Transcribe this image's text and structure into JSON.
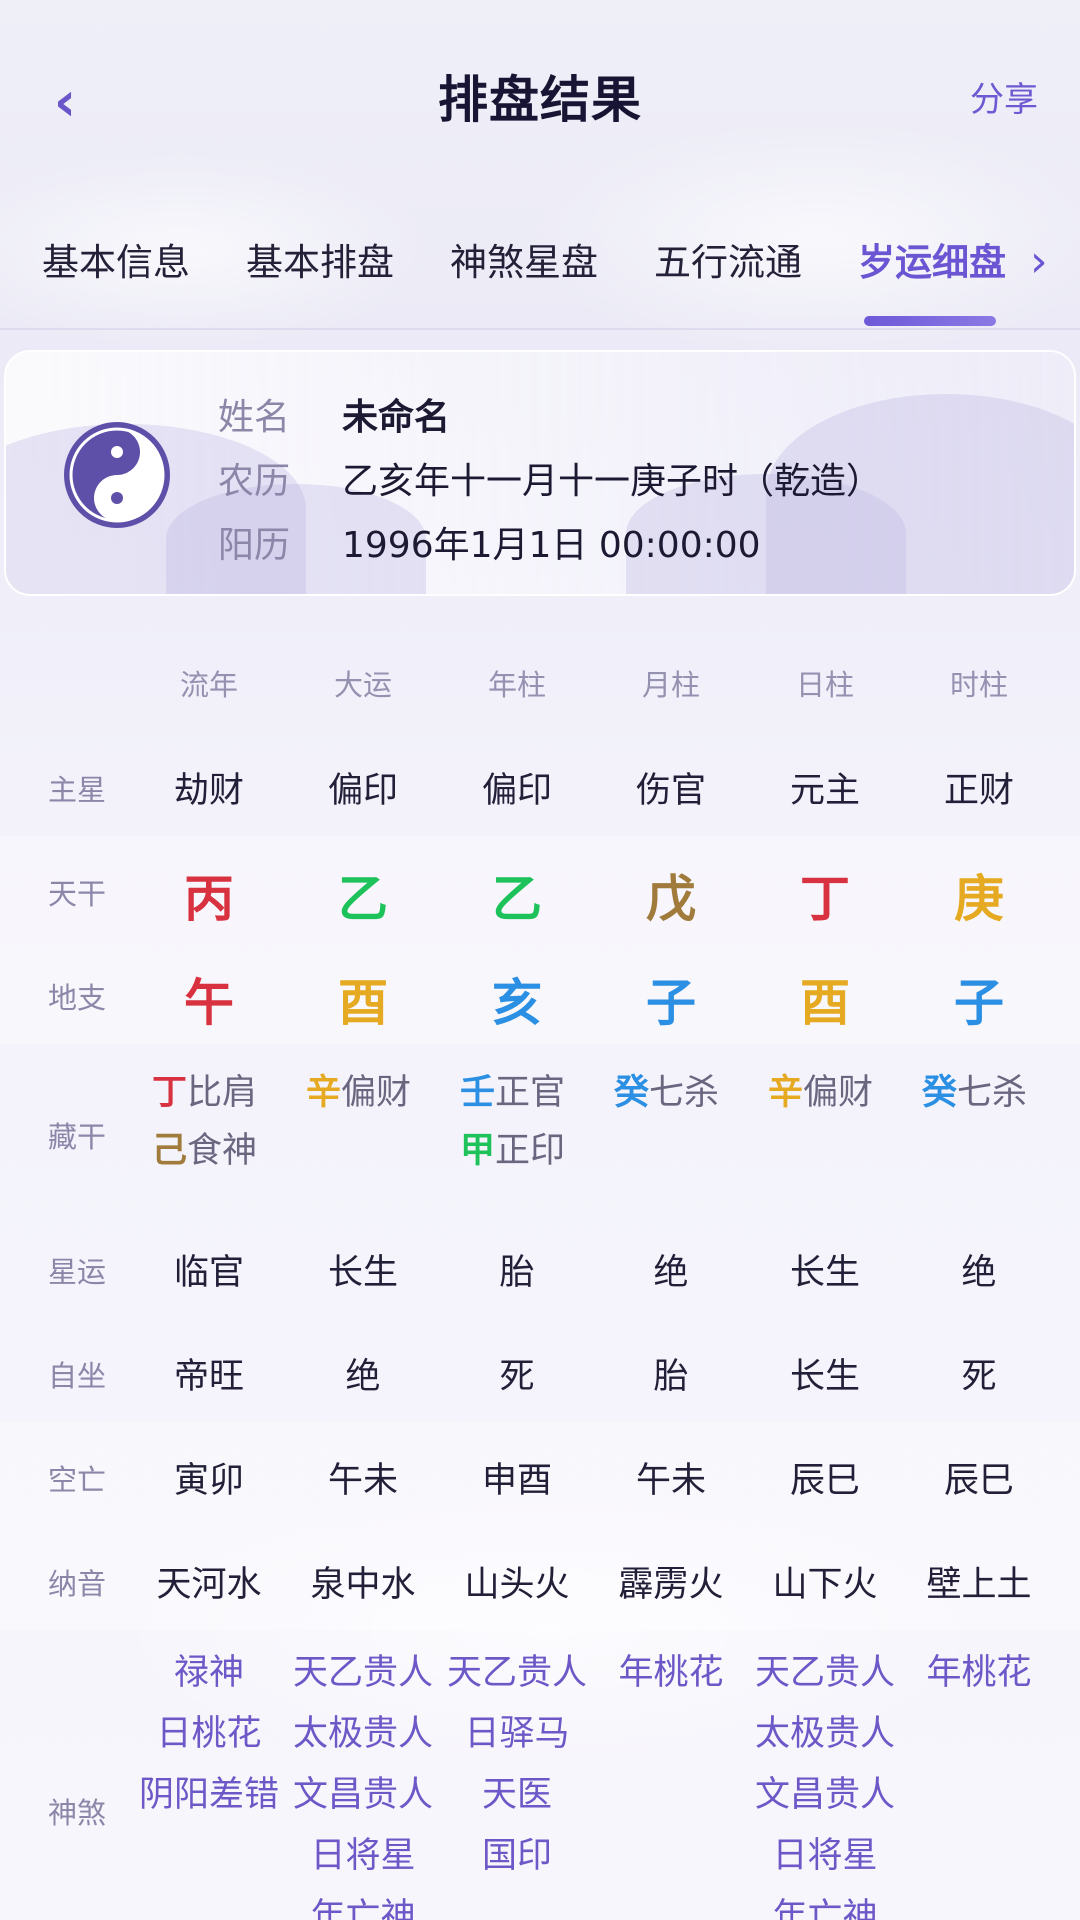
{
  "header": {
    "back_icon": "chevron-left-icon",
    "title": "排盘结果",
    "share_label": "分享"
  },
  "tabs": [
    {
      "label": "基本信息",
      "active": false
    },
    {
      "label": "基本排盘",
      "active": false
    },
    {
      "label": "神煞星盘",
      "active": false
    },
    {
      "label": "五行流通",
      "active": false
    },
    {
      "label": "岁运细盘",
      "active": true
    }
  ],
  "profile": {
    "icon": "yin-yang-icon",
    "name_label": "姓名",
    "name": "未命名",
    "lunar_label": "农历",
    "lunar": "乙亥年十一月十一庚子时（乾造）",
    "solar_label": "阳历",
    "solar": "1996年1月1日 00:00:00"
  },
  "table": {
    "columns": [
      "流年",
      "大运",
      "年柱",
      "月柱",
      "日柱",
      "时柱"
    ],
    "main_star": {
      "label": "主星",
      "values": [
        "劫财",
        "偏印",
        "偏印",
        "伤官",
        "元主",
        "正财"
      ]
    },
    "heavenly_stem": {
      "label": "天干",
      "values": [
        "丙",
        "乙",
        "乙",
        "戊",
        "丁",
        "庚"
      ],
      "colors": [
        "#d8313f",
        "#1ec25a",
        "#1ec25a",
        "#a07b3c",
        "#d8313f",
        "#e5aa22"
      ]
    },
    "earthly_branch": {
      "label": "地支",
      "values": [
        "午",
        "酉",
        "亥",
        "子",
        "酉",
        "子"
      ],
      "colors": [
        "#d8313f",
        "#e5aa22",
        "#2b8fe3",
        "#2b8fe3",
        "#e5aa22",
        "#2b8fe3"
      ]
    },
    "hidden_stems": {
      "label": "藏干",
      "cols": [
        [
          {
            "stem": "丁",
            "god": "比肩",
            "color": "#d8313f"
          },
          {
            "stem": "己",
            "god": "食神",
            "color": "#a07b3c"
          }
        ],
        [
          {
            "stem": "辛",
            "god": "偏财",
            "color": "#e5aa22"
          }
        ],
        [
          {
            "stem": "壬",
            "god": "正官",
            "color": "#2b8fe3"
          },
          {
            "stem": "甲",
            "god": "正印",
            "color": "#1ec25a"
          }
        ],
        [
          {
            "stem": "癸",
            "god": "七杀",
            "color": "#2b8fe3"
          }
        ],
        [
          {
            "stem": "辛",
            "god": "偏财",
            "color": "#e5aa22"
          }
        ],
        [
          {
            "stem": "癸",
            "god": "七杀",
            "color": "#2b8fe3"
          }
        ]
      ]
    },
    "star_fortune": {
      "label": "星运",
      "values": [
        "临官",
        "长生",
        "胎",
        "绝",
        "长生",
        "绝"
      ]
    },
    "self_seat": {
      "label": "自坐",
      "values": [
        "帝旺",
        "绝",
        "死",
        "胎",
        "长生",
        "死"
      ]
    },
    "void": {
      "label": "空亡",
      "values": [
        "寅卯",
        "午未",
        "申酉",
        "午未",
        "辰巳",
        "辰巳"
      ]
    },
    "nayin": {
      "label": "纳音",
      "values": [
        "天河水",
        "泉中水",
        "山头火",
        "霹雳火",
        "山下火",
        "壁上土"
      ]
    },
    "shensha": {
      "label": "神煞",
      "cols": [
        [
          "禄神",
          "日桃花",
          "阴阳差错"
        ],
        [
          "天乙贵人",
          "太极贵人",
          "文昌贵人",
          "日将星",
          "年亡神"
        ],
        [
          "天乙贵人",
          "日驿马",
          "天医",
          "国印"
        ],
        [
          "年桃花"
        ],
        [
          "天乙贵人",
          "太极贵人",
          "文昌贵人",
          "日将星",
          "年亡神"
        ],
        [
          "年桃花"
        ]
      ]
    }
  }
}
